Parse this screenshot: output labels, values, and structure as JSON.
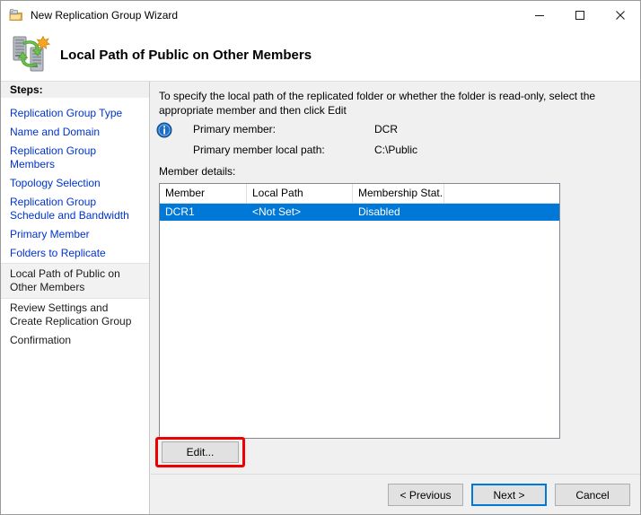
{
  "window": {
    "title": "New Replication Group Wizard",
    "title_icon": "replication-folder-icon",
    "caption": {
      "minimize": "minimize-icon",
      "maximize": "maximize-icon",
      "close": "close-icon"
    }
  },
  "header": {
    "title": "Local Path of Public on Other Members",
    "icon": "replication-servers-icon"
  },
  "sidebar": {
    "heading": "Steps:",
    "items": [
      {
        "label": "Replication Group Type",
        "state": "link"
      },
      {
        "label": "Name and Domain",
        "state": "link"
      },
      {
        "label": "Replication Group Members",
        "state": "link"
      },
      {
        "label": "Topology Selection",
        "state": "link"
      },
      {
        "label": "Replication Group Schedule and Bandwidth",
        "state": "link"
      },
      {
        "label": "Primary Member",
        "state": "link"
      },
      {
        "label": "Folders to Replicate",
        "state": "link"
      },
      {
        "label": "Local Path of Public on Other Members",
        "state": "current"
      },
      {
        "label": "Review Settings and Create Replication Group",
        "state": "plain"
      },
      {
        "label": "Confirmation",
        "state": "plain"
      }
    ]
  },
  "main": {
    "instruction": "To specify the local path of the replicated folder or whether the folder is read-only, select the appropriate member and then click Edit",
    "info_icon": "information-icon",
    "info_rows": [
      {
        "label": "Primary member:",
        "value": "DCR"
      },
      {
        "label": "Primary member local path:",
        "value": "C:\\Public"
      }
    ],
    "member_details_label": "Member details:",
    "table": {
      "columns": [
        "Member",
        "Local Path",
        "Membership Stat..."
      ],
      "rows": [
        {
          "cells": [
            "DCR1",
            "<Not Set>",
            "Disabled"
          ],
          "selected": true
        }
      ]
    },
    "edit_button": "Edit...",
    "highlight_color": "#ee0000",
    "selection_color": "#0078d7"
  },
  "footer": {
    "previous": "< Previous",
    "next": "Next >",
    "cancel": "Cancel"
  }
}
